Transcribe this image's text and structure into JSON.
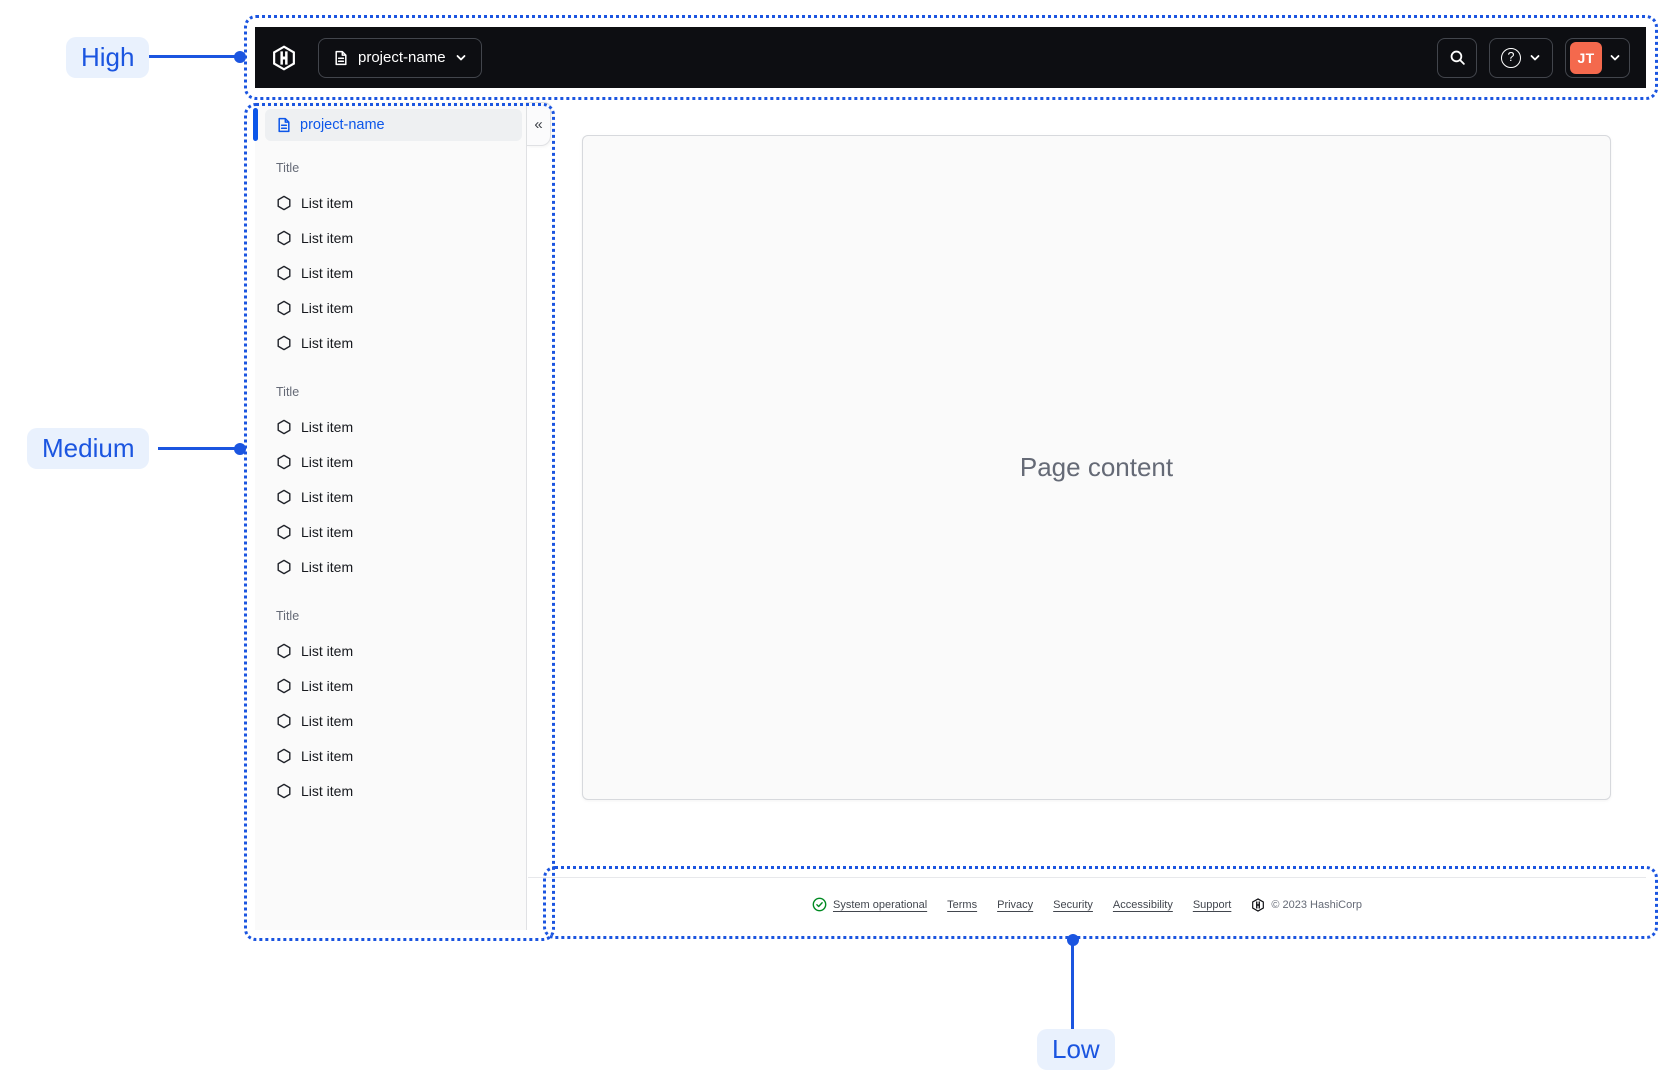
{
  "annotations": {
    "high_label": "High",
    "medium_label": "Medium",
    "low_label": "Low"
  },
  "topnav": {
    "project_switcher_label": "project-name"
  },
  "user": {
    "initials": "JT"
  },
  "sidebar": {
    "active_item_label": "project-name",
    "sections": [
      {
        "title": "Title",
        "items": [
          "List item",
          "List item",
          "List item",
          "List item",
          "List item"
        ]
      },
      {
        "title": "Title",
        "items": [
          "List item",
          "List item",
          "List item",
          "List item",
          "List item"
        ]
      },
      {
        "title": "Title",
        "items": [
          "List item",
          "List item",
          "List item",
          "List item",
          "List item"
        ]
      }
    ]
  },
  "main": {
    "placeholder": "Page content"
  },
  "footer": {
    "status_label": "System operational",
    "links": [
      "Terms",
      "Privacy",
      "Security",
      "Accessibility",
      "Support"
    ],
    "copyright": "© 2023 HashiCorp"
  },
  "icons": {
    "hashicorp_logo": "hexagon-h-mark",
    "file_text": "document-outline",
    "chevron_down": "chevron-down",
    "search": "magnifier",
    "help_glyph": "?",
    "collapse_glyph": "«",
    "status_check": "check-circle",
    "list_item_bullet": "hexagon-outline"
  },
  "colors": {
    "annotation_blue": "#1b55e0",
    "annotation_pill_bg": "#e9f1fd",
    "app_blue": "#0c56e9",
    "nav_black": "#0d0e12",
    "avatar_orange": "#f4694d",
    "success_green": "#008a22"
  }
}
